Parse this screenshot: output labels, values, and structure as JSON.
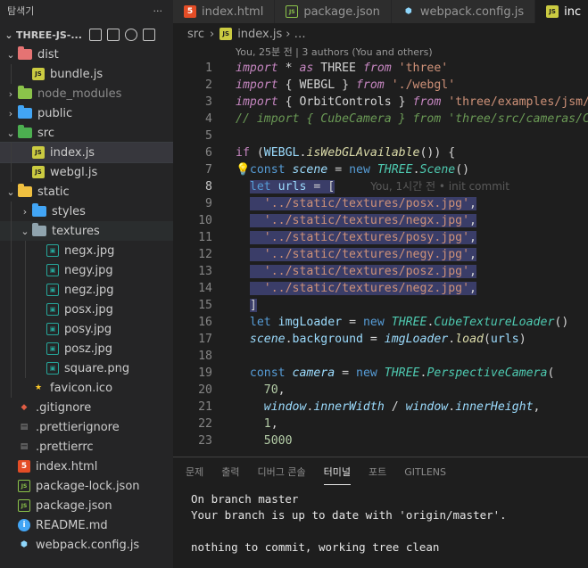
{
  "sidebar": {
    "title": "탐색기",
    "more": "···",
    "project": "THREE-JS-...",
    "tree": [
      {
        "label": "dist",
        "type": "folder",
        "color": "#e57373",
        "depth": 1,
        "chev": "⌄"
      },
      {
        "label": "bundle.js",
        "type": "js",
        "depth": 2
      },
      {
        "label": "node_modules",
        "type": "folder",
        "color": "#8bc34a",
        "depth": 1,
        "chev": "›",
        "dim": true
      },
      {
        "label": "public",
        "type": "folder",
        "color": "#42a5f5",
        "depth": 1,
        "chev": "›"
      },
      {
        "label": "src",
        "type": "folder",
        "color": "#4caf50",
        "depth": 1,
        "chev": "⌄"
      },
      {
        "label": "index.js",
        "type": "js",
        "depth": 2,
        "selected": true
      },
      {
        "label": "webgl.js",
        "type": "js",
        "depth": 2
      },
      {
        "label": "static",
        "type": "folder",
        "color": "#f0c040",
        "depth": 1,
        "chev": "⌄"
      },
      {
        "label": "styles",
        "type": "folder",
        "color": "#42a5f5",
        "depth": 2,
        "chev": "›"
      },
      {
        "label": "textures",
        "type": "folder",
        "color": "#90a4ae",
        "depth": 2,
        "chev": "⌄",
        "focus": true
      },
      {
        "label": "negx.jpg",
        "type": "jpg",
        "depth": 3
      },
      {
        "label": "negy.jpg",
        "type": "jpg",
        "depth": 3
      },
      {
        "label": "negz.jpg",
        "type": "jpg",
        "depth": 3
      },
      {
        "label": "posx.jpg",
        "type": "jpg",
        "depth": 3
      },
      {
        "label": "posy.jpg",
        "type": "jpg",
        "depth": 3
      },
      {
        "label": "posz.jpg",
        "type": "jpg",
        "depth": 3
      },
      {
        "label": "square.png",
        "type": "jpg",
        "depth": 3
      },
      {
        "label": "favicon.ico",
        "type": "star",
        "depth": 2
      },
      {
        "label": ".gitignore",
        "type": "git",
        "depth": 1
      },
      {
        "label": ".prettierignore",
        "type": "prettier",
        "depth": 1
      },
      {
        "label": ".prettierrc",
        "type": "prettier",
        "depth": 1
      },
      {
        "label": "index.html",
        "type": "html",
        "depth": 1
      },
      {
        "label": "package-lock.json",
        "type": "node",
        "depth": 1
      },
      {
        "label": "package.json",
        "type": "node",
        "depth": 1
      },
      {
        "label": "README.md",
        "type": "info",
        "depth": 1
      },
      {
        "label": "webpack.config.js",
        "type": "webpack",
        "depth": 1
      }
    ]
  },
  "tabs": [
    {
      "label": "index.html",
      "icon": "html"
    },
    {
      "label": "package.json",
      "icon": "node"
    },
    {
      "label": "webpack.config.js",
      "icon": "webpack"
    },
    {
      "label": "inc",
      "icon": "js",
      "active": true
    }
  ],
  "breadcrumb": {
    "folder": "src",
    "sep": "›",
    "file": "index.js",
    "sep2": "› …"
  },
  "editor": {
    "codelens": "You, 25분 전 | 3 authors (You and others)",
    "blame": "You, 1시간 전 • init commit",
    "current_line": "8"
  },
  "panel": {
    "tabs": [
      "문제",
      "출력",
      "디버그 콘솔",
      "터미널",
      "포트",
      "GITLENS"
    ],
    "active_tab": "터미널",
    "terminal": [
      "On branch master",
      "Your branch is up to date with 'origin/master'.",
      "",
      "nothing to commit, working tree clean"
    ]
  }
}
